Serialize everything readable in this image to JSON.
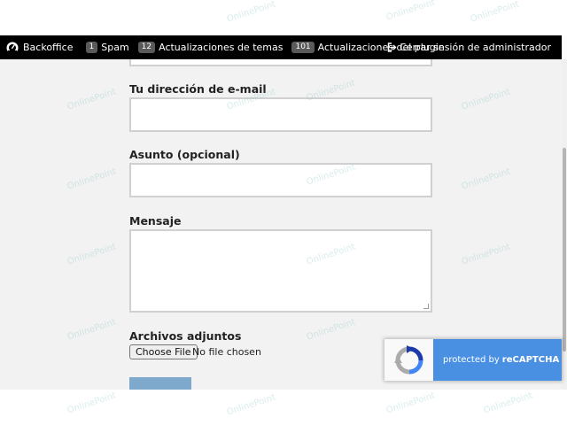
{
  "admin_bar": {
    "backoffice_label": "Backoffice",
    "spam_count": "1",
    "spam_label": "Spam",
    "theme_updates_count": "12",
    "theme_updates_label": "Actualizaciones de temas",
    "plugin_updates_count": "101",
    "plugin_updates_label": "Actualizaciones del plugin",
    "logout_label": "Cerrar sesión de administrador"
  },
  "form": {
    "email_label": "Tu dirección de e-mail",
    "email_value": "",
    "subject_label": "Asunto (opcional)",
    "subject_value": "",
    "message_label": "Mensaje",
    "message_value": "",
    "attachments_label": "Archivos adjuntos",
    "file_button_label": "Choose File",
    "file_status": "No file chosen"
  },
  "recaptcha": {
    "text_prefix": "protected by",
    "text_brand": "reCAPTCHA"
  },
  "watermark": {
    "text": "OnlinePoint"
  },
  "colors": {
    "admin_bar_bg": "#000000",
    "content_bg": "#f2f2f2",
    "recaptcha_blue": "#4a90e2",
    "submit_button": "#7fa9cc"
  }
}
